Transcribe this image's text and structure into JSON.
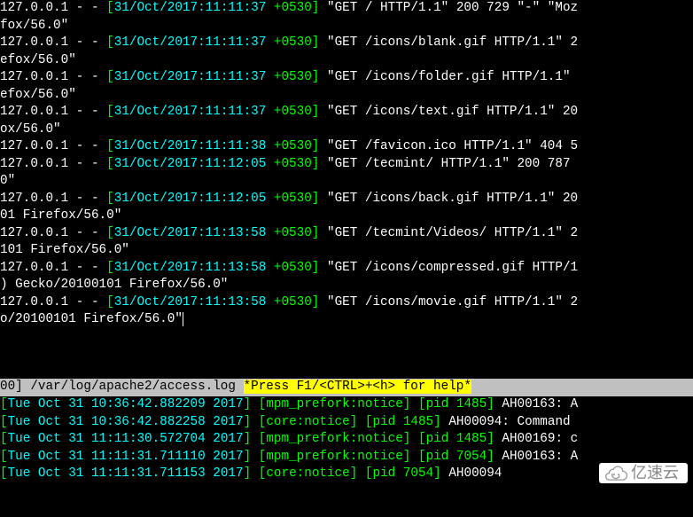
{
  "access_log": [
    {
      "ip": "127.0.0.1",
      "ts": "31/Oct/2017:11:11:37",
      "tz": "+0530",
      "req": "\"GET / HTTP/1.1\" 200 729 \"-\" \"Moz",
      "wrap": "fox/56.0\""
    },
    {
      "ip": "127.0.0.1",
      "ts": "31/Oct/2017:11:11:37",
      "tz": "+0530",
      "req": "\"GET /icons/blank.gif HTTP/1.1\" 2",
      "wrap": "efox/56.0\""
    },
    {
      "ip": "127.0.0.1",
      "ts": "31/Oct/2017:11:11:37",
      "tz": "+0530",
      "req": "\"GET /icons/folder.gif HTTP/1.1\" ",
      "wrap": "efox/56.0\""
    },
    {
      "ip": "127.0.0.1",
      "ts": "31/Oct/2017:11:11:37",
      "tz": "+0530",
      "req": "\"GET /icons/text.gif HTTP/1.1\" 20",
      "wrap": "ox/56.0\""
    },
    {
      "ip": "127.0.0.1",
      "ts": "31/Oct/2017:11:11:38",
      "tz": "+0530",
      "req": "\"GET /favicon.ico HTTP/1.1\" 404 5",
      "wrap": null
    },
    {
      "ip": "127.0.0.1",
      "ts": "31/Oct/2017:11:12:05",
      "tz": "+0530",
      "req": "\"GET /tecmint/ HTTP/1.1\" 200 787 ",
      "wrap": "0\""
    },
    {
      "ip": "127.0.0.1",
      "ts": "31/Oct/2017:11:12:05",
      "tz": "+0530",
      "req": "\"GET /icons/back.gif HTTP/1.1\" 20",
      "wrap": "01 Firefox/56.0\""
    },
    {
      "ip": "127.0.0.1",
      "ts": "31/Oct/2017:11:13:58",
      "tz": "+0530",
      "req": "\"GET /tecmint/Videos/ HTTP/1.1\" 2",
      "wrap": "101 Firefox/56.0\""
    },
    {
      "ip": "127.0.0.1",
      "ts": "31/Oct/2017:11:13:58",
      "tz": "+0530",
      "req": "\"GET /icons/compressed.gif HTTP/1",
      "wrap": ") Gecko/20100101 Firefox/56.0\""
    },
    {
      "ip": "127.0.0.1",
      "ts": "31/Oct/2017:11:13:58",
      "tz": "+0530",
      "req": "\"GET /icons/movie.gif HTTP/1.1\" 2",
      "wrap": "o/20100101 Firefox/56.0\""
    }
  ],
  "status": {
    "left": "00] /var/log/apache2/access.log ",
    "help": "*Press F1/<CTRL>+<h> for help*"
  },
  "error_log": [
    {
      "ts": "Tue Oct 31 10:36:42.882209 2017",
      "mod": "mpm_prefork:notice",
      "pid": "pid 1485",
      "msg": "AH00163: A"
    },
    {
      "ts": "Tue Oct 31 10:36:42.882258 2017",
      "mod": "core:notice",
      "pid": "pid 1485",
      "msg": "AH00094: Command "
    },
    {
      "ts": "Tue Oct 31 11:11:30.572704 2017",
      "mod": "mpm_prefork:notice",
      "pid": "pid 1485",
      "msg": "AH00169: c"
    },
    {
      "ts": "Tue Oct 31 11:11:31.711110 2017",
      "mod": "mpm_prefork:notice",
      "pid": "pid 7054",
      "msg": "AH00163: A"
    },
    {
      "ts": "Tue Oct 31 11:11:31.711153 2017",
      "mod": "core:notice",
      "pid": "pid 7054",
      "msg": "AH00094"
    }
  ],
  "watermark": "亿速云"
}
